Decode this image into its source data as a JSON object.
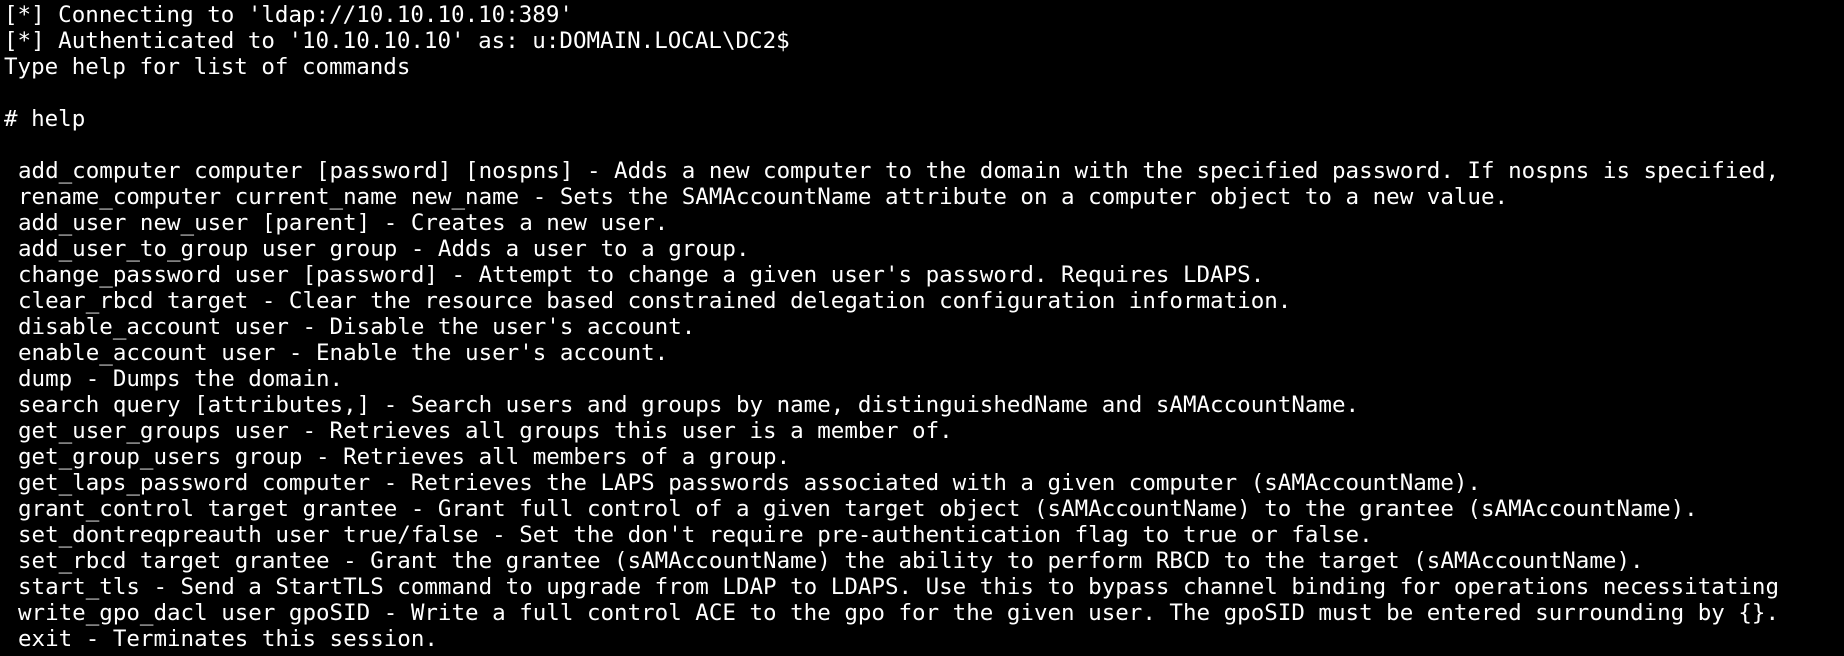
{
  "terminal": {
    "background": "#000000",
    "foreground": "#ffffff",
    "header_lines": [
      "[*] Connecting to 'ldap://10.10.10.10:389'",
      "[*] Authenticated to '10.10.10.10' as: u:DOMAIN.LOCAL\\DC2$",
      "Type help for list of commands"
    ],
    "prompt_line": "# help",
    "help_lines": [
      "add_computer computer [password] [nospns] - Adds a new computer to the domain with the specified password. If nospns is specified,",
      "rename_computer current_name new_name - Sets the SAMAccountName attribute on a computer object to a new value.",
      "add_user new_user [parent] - Creates a new user.",
      "add_user_to_group user group - Adds a user to a group.",
      "change_password user [password] - Attempt to change a given user's password. Requires LDAPS.",
      "clear_rbcd target - Clear the resource based constrained delegation configuration information.",
      "disable_account user - Disable the user's account.",
      "enable_account user - Enable the user's account.",
      "dump - Dumps the domain.",
      "search query [attributes,] - Search users and groups by name, distinguishedName and sAMAccountName.",
      "get_user_groups user - Retrieves all groups this user is a member of.",
      "get_group_users group - Retrieves all members of a group.",
      "get_laps_password computer - Retrieves the LAPS passwords associated with a given computer (sAMAccountName).",
      "grant_control target grantee - Grant full control of a given target object (sAMAccountName) to the grantee (sAMAccountName).",
      "set_dontreqpreauth user true/false - Set the don't require pre-authentication flag to true or false.",
      "set_rbcd target grantee - Grant the grantee (sAMAccountName) the ability to perform RBCD to the target (sAMAccountName).",
      "start_tls - Send a StartTLS command to upgrade from LDAP to LDAPS. Use this to bypass channel binding for operations necessitating",
      "write_gpo_dacl user gpoSID - Write a full control ACE to the gpo for the given user. The gpoSID must be entered surrounding by {}.",
      "exit - Terminates this session."
    ]
  }
}
